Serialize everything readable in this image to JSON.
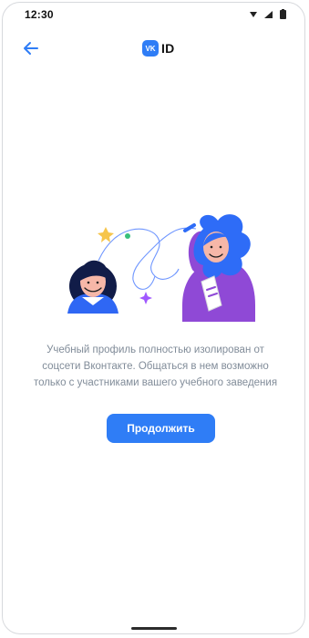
{
  "status_bar": {
    "time": "12:30",
    "icons": [
      "wifi-icon",
      "signal-icon",
      "battery-icon"
    ]
  },
  "header": {
    "back_icon": "arrow-left-icon",
    "logo_mark": "VK",
    "logo_text": "ID"
  },
  "illustration": {
    "name": "teacher-and-student-illustration"
  },
  "content": {
    "description": "Учебный профиль полностью изолирован от соцсети Вконтакте. Общаться в нем возможно только с участниками вашего учебного заведения",
    "continue_label": "Продолжить"
  },
  "colors": {
    "accent": "#2f7df6",
    "text_secondary": "#818c99",
    "illustration_purple": "#8f49d6",
    "illustration_blue": "#2e6cf7"
  }
}
